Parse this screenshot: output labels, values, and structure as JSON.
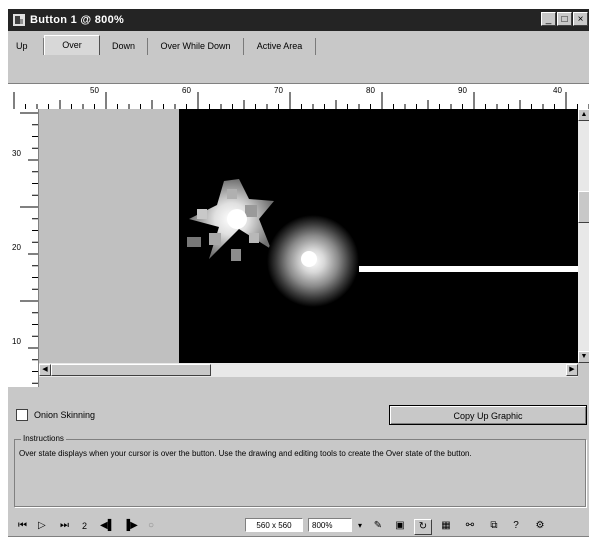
{
  "window": {
    "title": "Button 1 @ 800%",
    "controls": {
      "minimize": "_",
      "maximize": "□",
      "close": "×"
    }
  },
  "tabs": [
    {
      "label": "Up"
    },
    {
      "label": "Over",
      "active": true
    },
    {
      "label": "Down"
    },
    {
      "label": "Over While Down"
    },
    {
      "label": "Active Area"
    }
  ],
  "ruler": {
    "horizontal_labels": [
      "50",
      "60",
      "70",
      "80",
      "90",
      "40"
    ],
    "vertical_labels": [
      "30",
      "20",
      "10"
    ]
  },
  "options": {
    "onion_skinning_label": "Onion Skinning",
    "onion_skinning_checked": false,
    "copy_button_label": "Copy Up Graphic"
  },
  "instructions": {
    "title": "Instructions",
    "text": "Over state displays when your cursor is over the button. Use the drawing and editing tools to create the Over state of the button."
  },
  "toolbar": {
    "frame_number": "2",
    "canvas_size": "560 x 560",
    "zoom": "800%",
    "icons": [
      "first-frame-icon",
      "play-icon",
      "last-frame-icon",
      "prev-frame-icon",
      "next-frame-icon",
      "loop-icon",
      "pencil-icon",
      "export-icon",
      "quick-export-icon",
      "optimize-icon",
      "link-icon",
      "library-icon",
      "help-icon",
      "settings-icon"
    ]
  },
  "colors": {
    "title_bar": "#242424",
    "stage": "#000000",
    "pasteboard": "#c0c0c0",
    "chrome": "#c8c8c8"
  }
}
